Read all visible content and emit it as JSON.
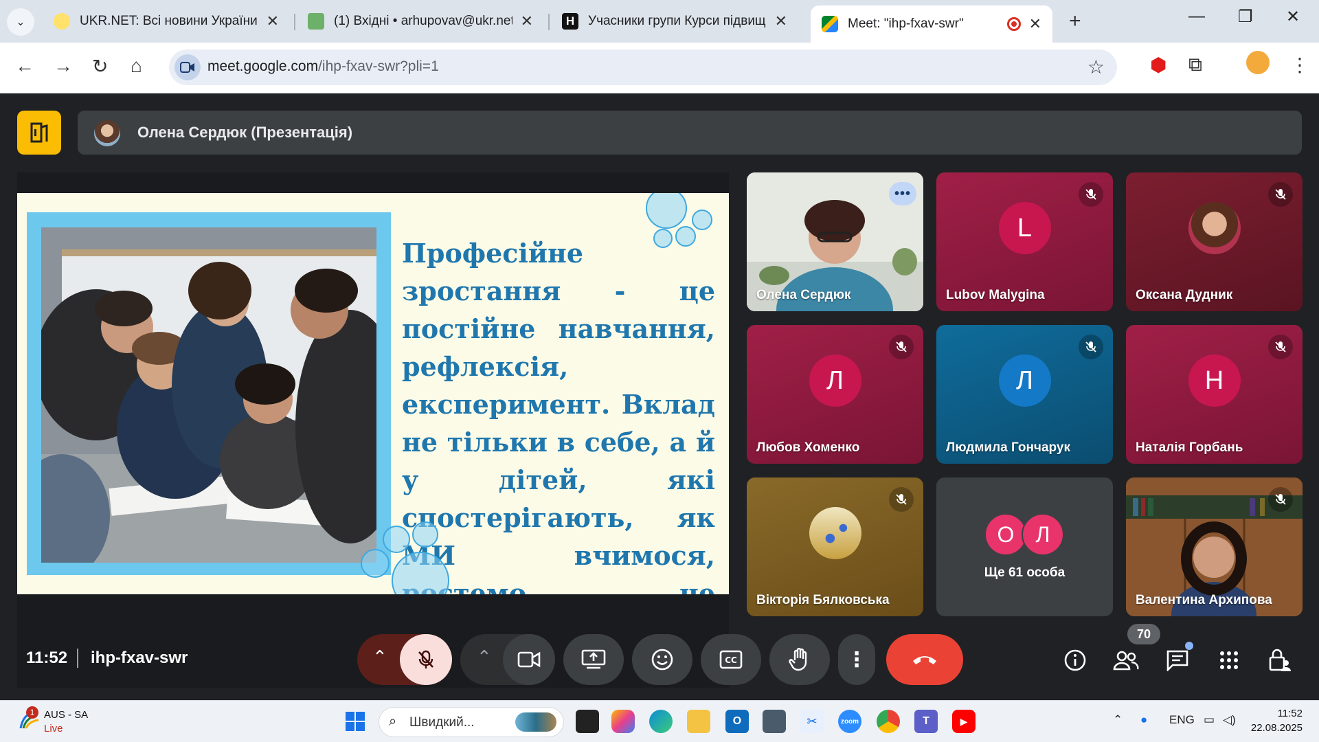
{
  "browser": {
    "tabs": [
      {
        "title": "UKR.NET: Всі новини України, о",
        "favicon": "ukrnet-icon",
        "active": false
      },
      {
        "title": "(1) Вхідні • arhupovav@ukr.net",
        "favicon": "mail-icon",
        "active": false
      },
      {
        "title": "Учасники групи Курси підвищ",
        "favicon": "h-icon",
        "active": false
      },
      {
        "title": "Meet: \"ihp-fxav-swr\"",
        "favicon": "meet-icon",
        "active": true
      }
    ],
    "url_host": "meet.google.com",
    "url_path": "/ihp-fxav-swr?pli=1"
  },
  "presentation": {
    "presenter": "Олена Сердюк (Презентація)",
    "slide_text": "Професійне зростання - це постійне навчання, рефлексія, експеримент. Вклад не тільки в себе, а й у дітей, які спостерігають, як МИ вчимося, ростемо , не боїмося змін"
  },
  "participants": [
    {
      "name": "Олена Сердюк",
      "type": "video",
      "speaking": true
    },
    {
      "name": "Lubov Malygina",
      "initial": "L",
      "muted": true,
      "bg": "#8f1a3f",
      "avatar_color": "#c8174f"
    },
    {
      "name": "Оксана Дудник",
      "type": "photo",
      "muted": true,
      "bg": "#6e1b2b"
    },
    {
      "name": "Любов Хоменко",
      "initial": "Л",
      "muted": true,
      "bg": "#8e1c42",
      "avatar_color": "#c8174f"
    },
    {
      "name": "Людмила Гончарук",
      "initial": "Л",
      "muted": true,
      "bg": "#0e5c86",
      "avatar_color": "#1479c7"
    },
    {
      "name": "Наталія Горбань",
      "initial": "Н",
      "muted": true,
      "bg": "#8e1c42",
      "avatar_color": "#c8174f"
    },
    {
      "name": "Вікторія Бялковська",
      "type": "photo",
      "muted": true,
      "bg": "#7a5a20"
    }
  ],
  "others": {
    "label": "Ще 61 особа",
    "initials": [
      "О",
      "Л"
    ]
  },
  "self_tile": {
    "name": "Валентина Архипова"
  },
  "controls": {
    "time": "11:52",
    "meeting_code": "ihp-fxav-swr",
    "participant_count": "70"
  },
  "taskbar": {
    "weather_line1": "AUS - SA",
    "weather_line2": "Live",
    "weather_badge": "1",
    "search_placeholder": "Швидкий...",
    "lang": "ENG",
    "clock_time": "11:52",
    "clock_date": "22.08.2025"
  },
  "colors": {
    "meet_bg": "#202124",
    "accent": "#fbbc04",
    "end_call": "#ea4335",
    "slide_text": "#1f77ad"
  }
}
